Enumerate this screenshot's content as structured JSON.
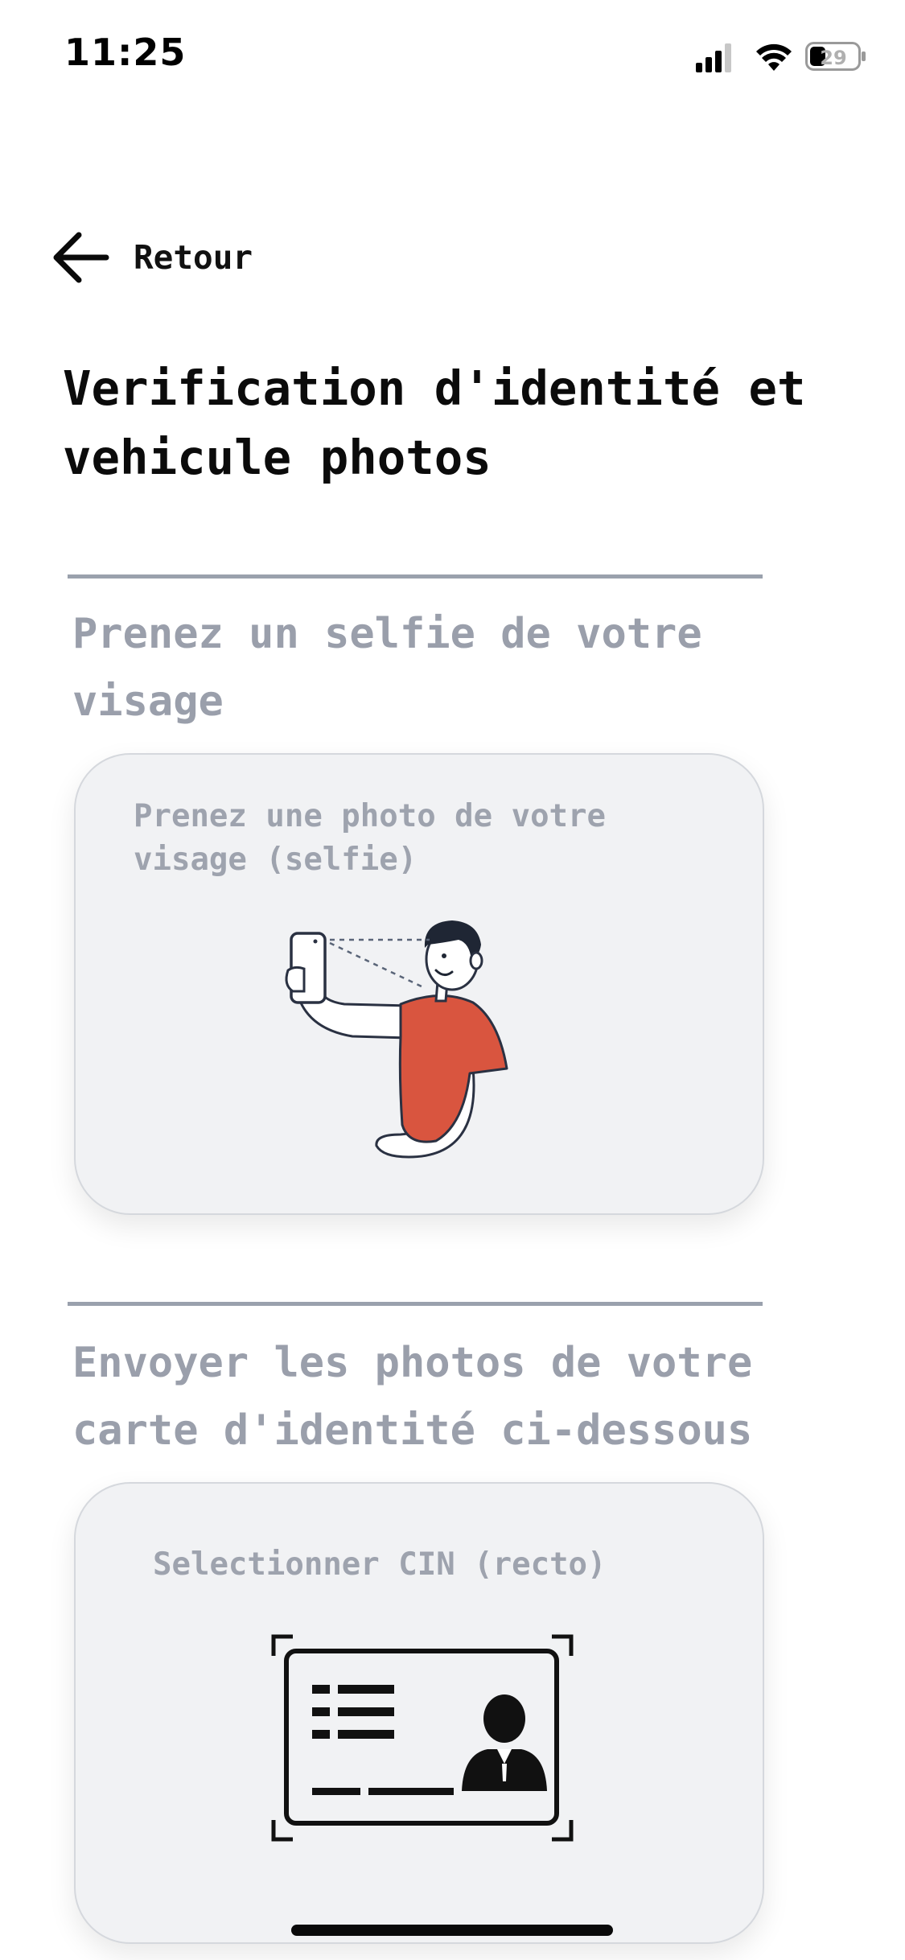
{
  "status_bar": {
    "time": "11:25",
    "battery": "29",
    "icons": [
      "cellular-signal-icon",
      "wifi-icon",
      "battery-icon"
    ]
  },
  "nav": {
    "back_label": "Retour",
    "back_icon": "arrow-left-icon"
  },
  "page": {
    "title": "Verification d'identité et vehicule photos"
  },
  "sections": [
    {
      "title": "Prenez un selfie de votre visage",
      "card_label": "Prenez une photo de votre visage (selfie)",
      "illustration": "selfie-illustration"
    },
    {
      "title": "Envoyer les photos de votre carte d'identité ci-dessous",
      "card_label": "Selectionner CIN (recto)",
      "illustration": "id-card-icon"
    }
  ],
  "colors": {
    "muted_text": "#9a9fab",
    "card_bg": "#f1f2f4",
    "divider": "#9aa1ad",
    "shirt": "#d9553f",
    "primary_text": "#111111"
  }
}
